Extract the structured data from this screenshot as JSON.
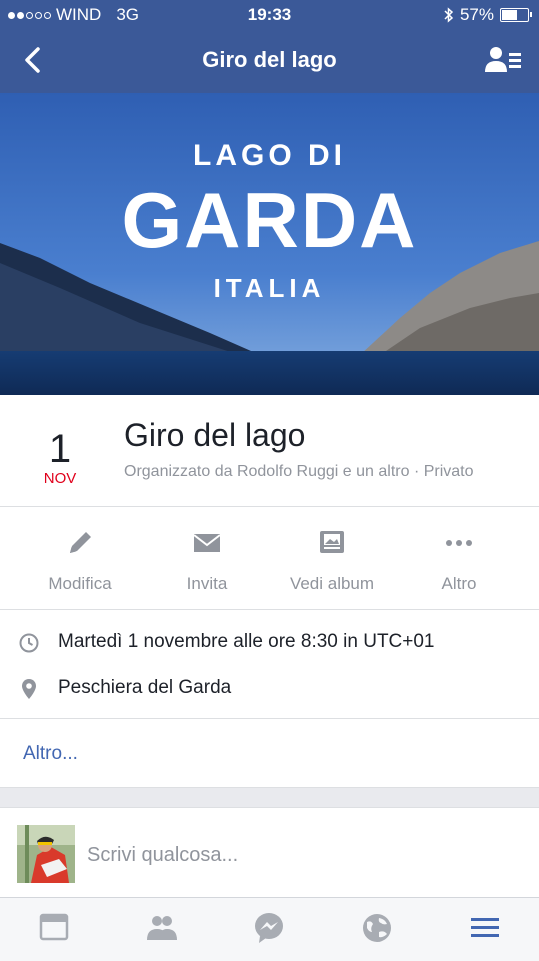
{
  "status_bar": {
    "carrier": "WIND",
    "network": "3G",
    "time": "19:33",
    "battery": "57%",
    "battery_level": 0.57,
    "signal_bars": 2
  },
  "nav": {
    "title": "Giro del lago",
    "back_icon": "chevron-left-icon",
    "right_icon": "friends-list-icon"
  },
  "cover": {
    "line1": "LAGO DI",
    "line2": "GARDA",
    "line3": "ITALIA"
  },
  "event": {
    "day": "1",
    "month": "NOV",
    "title": "Giro del lago",
    "subtitle": "Organizzato da Rodolfo Ruggi e un altro · Privato"
  },
  "actions": [
    {
      "label": "Modifica",
      "icon": "pencil-icon"
    },
    {
      "label": "Invita",
      "icon": "envelope-icon"
    },
    {
      "label": "Vedi album",
      "icon": "album-icon"
    },
    {
      "label": "Altro",
      "icon": "more-dots-icon"
    }
  ],
  "details": {
    "time_text": "Martedì 1 novembre alle ore 8:30 in UTC+01",
    "location_text": "Peschiera del Garda"
  },
  "more_link": "Altro...",
  "composer": {
    "placeholder": "Scrivi qualcosa..."
  },
  "tabs": [
    "news-feed-icon",
    "friends-icon",
    "messenger-icon",
    "globe-icon",
    "menu-icon"
  ],
  "colors": {
    "brand": "#3b5998",
    "link": "#4267b2",
    "month": "#e0001b",
    "active_tab": "#4267b2"
  }
}
